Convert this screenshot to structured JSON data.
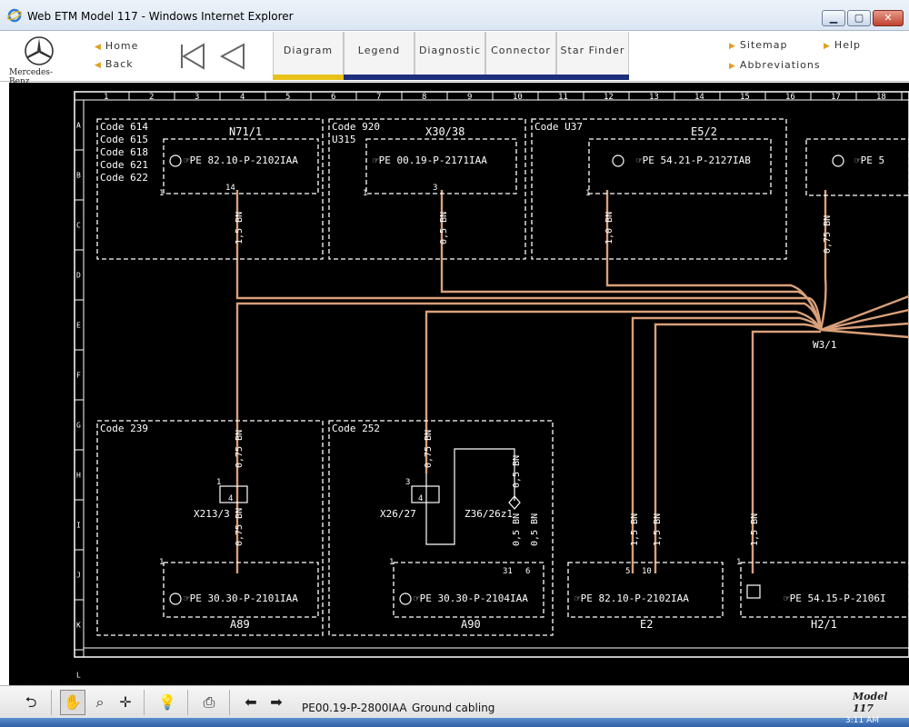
{
  "window": {
    "title": "Web ETM Model 117 - Windows Internet Explorer",
    "min_glyph": "▁",
    "max_glyph": "▢",
    "close_glyph": "✕"
  },
  "nav": {
    "brand": "Mercedes-Benz",
    "home": "Home",
    "back": "Back",
    "tabs": [
      {
        "label": "Diagram",
        "underline": "#e8c21a"
      },
      {
        "label": "Legend",
        "underline": "#1e2f7a"
      },
      {
        "label": "Diagnostic",
        "underline": "#1e2f7a"
      },
      {
        "label": "Connector",
        "underline": "#1e2f7a"
      },
      {
        "label": "Star Finder",
        "underline": "#1e2f7a"
      }
    ],
    "sitemap": "Sitemap",
    "help": "Help",
    "abbreviations": "Abbreviations"
  },
  "diagram": {
    "columns": [
      "1",
      "2",
      "3",
      "4",
      "5",
      "6",
      "7",
      "8",
      "9",
      "10",
      "11",
      "12",
      "13",
      "14",
      "15",
      "16",
      "17",
      "18"
    ],
    "rows": [
      "A",
      "B",
      "C",
      "D",
      "E",
      "F",
      "G",
      "H",
      "I",
      "J",
      "K",
      "L"
    ],
    "boxes": {
      "n71": {
        "codes": [
          "Code 614",
          "Code 615",
          "Code 618",
          "Code 621",
          "Code 622"
        ],
        "name": "N71/1",
        "ref": "☞PE 82.10-P-2102IAA",
        "pin": "14",
        "pin_left": "1"
      },
      "x30": {
        "codes": [
          "Code 920",
          "U315"
        ],
        "name": "X30/38",
        "ref": "☞PE 00.19-P-2171IAA",
        "pin": "3",
        "pin_left": "1"
      },
      "e5": {
        "codes": [
          "Code U37"
        ],
        "name": "E5/2",
        "ref": "☞PE 54.21-P-2127IAB",
        "pin_left": "1"
      },
      "right_top": {
        "ref": "☞PE 5"
      },
      "a89": {
        "codes": [
          "Code 239"
        ],
        "name": "A89",
        "ref": "☞PE 30.30-P-2101IAA",
        "pin_left": "1"
      },
      "a90": {
        "codes": [
          "Code 252"
        ],
        "name": "A90",
        "ref": "☞PE 30.30-P-2104IAA",
        "pin_left": "1",
        "pin_a": "31",
        "pin_b": "6"
      },
      "e2": {
        "name": "E2",
        "ref": "☞PE 82.10-P-2102IAA",
        "pin_a": "5",
        "pin_b": "10"
      },
      "h2": {
        "name": "H2/1",
        "ref": "☞PE 54.15-P-2106I",
        "pin_left": "1"
      }
    },
    "wires": {
      "n71": "1,5 BN",
      "x30": "0,5 BN",
      "e5": "1,0 BN",
      "right_top": "0,75 BN",
      "a89_top": "0,75 BN",
      "a89_bottom": "0,75 BN",
      "x26": "0,75 BN",
      "z36_top": "0,5 BN",
      "z36_a": "0,5 BN",
      "z36_b": "0,5 BN",
      "e2_a": "1,5 BN",
      "e2_b": "1,5 BN",
      "h2": "1,5 BN"
    },
    "connectors": {
      "x213": "X213/3",
      "x26": "X26/27",
      "z36": "Z36/26z1",
      "w3": "W3/1",
      "x213_pin1": "1",
      "x213_pin4": "4",
      "x26_pin3": "3",
      "x26_pin4": "4"
    },
    "wire_color": "#d9a07a"
  },
  "bottombar": {
    "document_code": "PE00.19-P-2800IAA",
    "document_title": "Ground cabling",
    "model": "Model 117"
  },
  "taskbar": {
    "clock": "3:11 AM"
  }
}
